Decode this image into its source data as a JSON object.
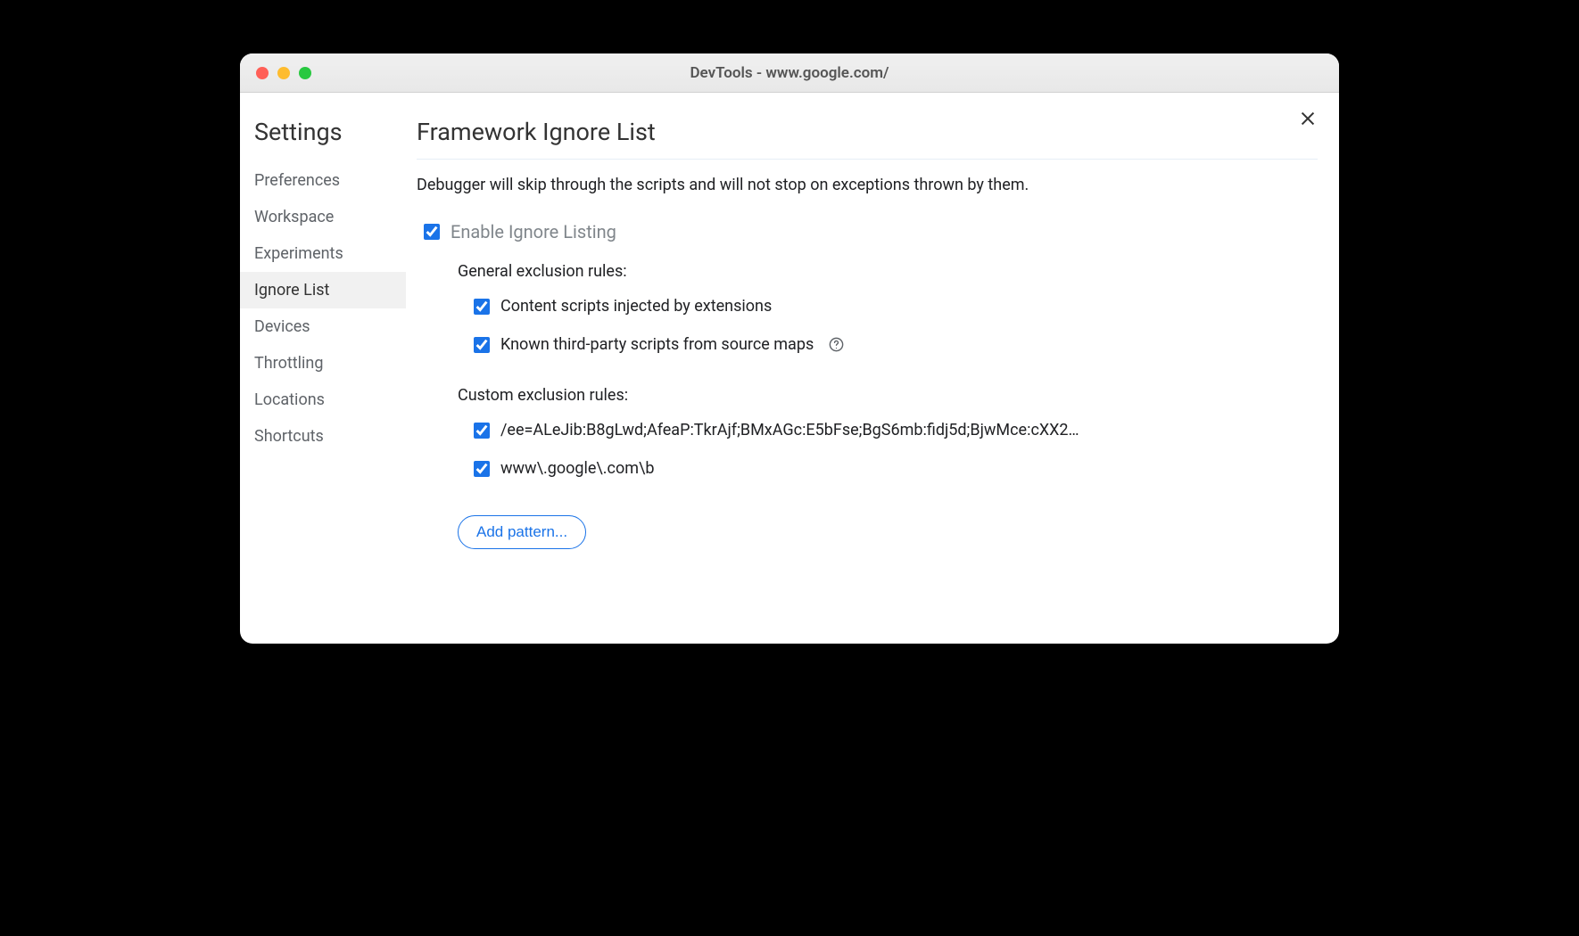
{
  "window": {
    "title": "DevTools - www.google.com/"
  },
  "sidebar": {
    "title": "Settings",
    "items": [
      {
        "label": "Preferences",
        "active": false
      },
      {
        "label": "Workspace",
        "active": false
      },
      {
        "label": "Experiments",
        "active": false
      },
      {
        "label": "Ignore List",
        "active": true
      },
      {
        "label": "Devices",
        "active": false
      },
      {
        "label": "Throttling",
        "active": false
      },
      {
        "label": "Locations",
        "active": false
      },
      {
        "label": "Shortcuts",
        "active": false
      }
    ]
  },
  "main": {
    "title": "Framework Ignore List",
    "description": "Debugger will skip through the scripts and will not stop on exceptions thrown by them.",
    "enable_label": "Enable Ignore Listing",
    "general_label": "General exclusion rules:",
    "general_rules": [
      {
        "label": "Content scripts injected by extensions",
        "has_help": false
      },
      {
        "label": "Known third-party scripts from source maps",
        "has_help": true
      }
    ],
    "custom_label": "Custom exclusion rules:",
    "custom_rules": [
      {
        "pattern": "/ee=ALeJib:B8gLwd;AfeaP:TkrAjf;BMxAGc:E5bFse;BgS6mb:fidj5d;BjwMce:cXX2…"
      },
      {
        "pattern": "www\\.google\\.com\\b"
      }
    ],
    "add_pattern_label": "Add pattern..."
  }
}
